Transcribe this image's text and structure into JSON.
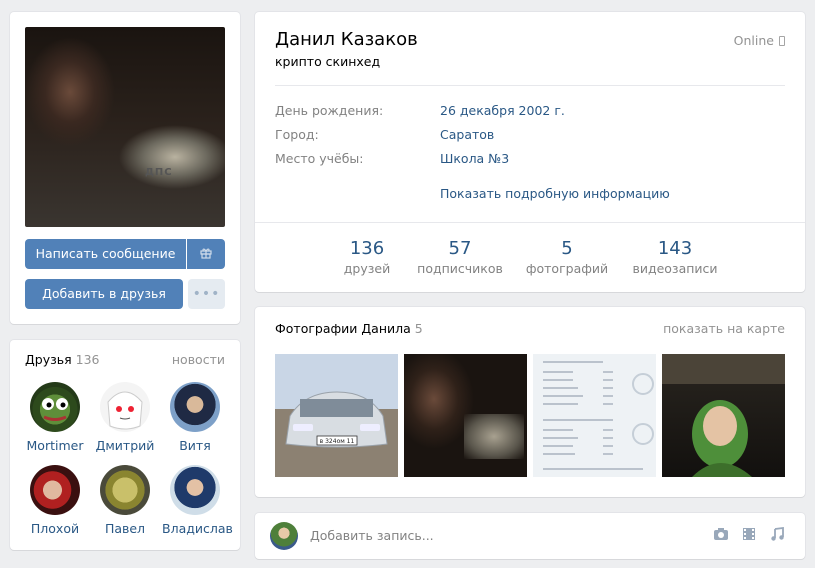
{
  "profile": {
    "name": "Данил Казаков",
    "status": "крипто скинхед",
    "online": "Online",
    "avatar_caption": "ДПС",
    "buttons": {
      "message": "Написать сообщение",
      "add_friend": "Добавить в друзья",
      "gift_icon": "gift-icon",
      "more_icon": "more-dots-icon"
    },
    "info": [
      {
        "label": "День рождения:",
        "value": "26 декабря 2002 г."
      },
      {
        "label": "Город:",
        "value": "Саратов"
      },
      {
        "label": "Место учёбы:",
        "value": "Школа №3"
      }
    ],
    "more_info_link": "Показать подробную информацию",
    "counters": [
      {
        "num": "136",
        "label": "друзей"
      },
      {
        "num": "57",
        "label": "подписчиков"
      },
      {
        "num": "5",
        "label": "фотографий"
      },
      {
        "num": "143",
        "label": "видеозаписи"
      }
    ]
  },
  "friends": {
    "title": "Друзья",
    "count": "136",
    "news_link": "новости",
    "items": [
      {
        "name": "Mortimer"
      },
      {
        "name": "Дмитрий"
      },
      {
        "name": "Витя"
      },
      {
        "name": "Плохой"
      },
      {
        "name": "Павел"
      },
      {
        "name": "Владислав"
      }
    ]
  },
  "photos": {
    "title": "Фотографии Данила",
    "count": "5",
    "map_link": "показать на карте",
    "plate_text": "в 324ом 11"
  },
  "wall": {
    "placeholder": "Добавить запись..."
  },
  "colors": {
    "link": "#2a5885",
    "button_primary": "#5181b8",
    "background": "#edeef0"
  }
}
